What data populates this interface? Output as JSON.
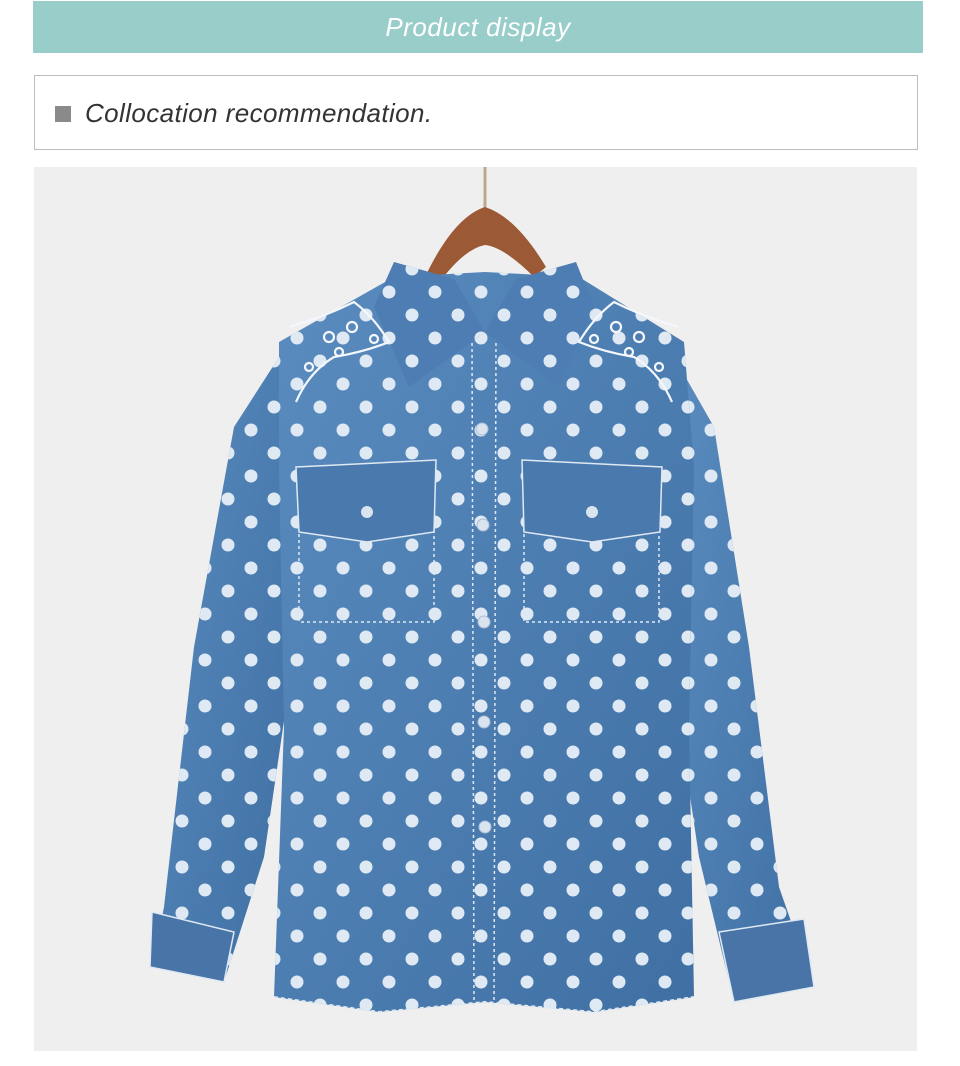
{
  "banner": {
    "title": "Product display"
  },
  "section": {
    "heading": "Collocation recommendation."
  },
  "photo": {
    "subject": "denim polka-dot shirt with lace shoulder detail on wooden hanger",
    "colors": {
      "background": "#efefef",
      "denim": "#4e7fb3",
      "dots": "#dfe9f3",
      "hanger": "#9b5a35"
    }
  }
}
